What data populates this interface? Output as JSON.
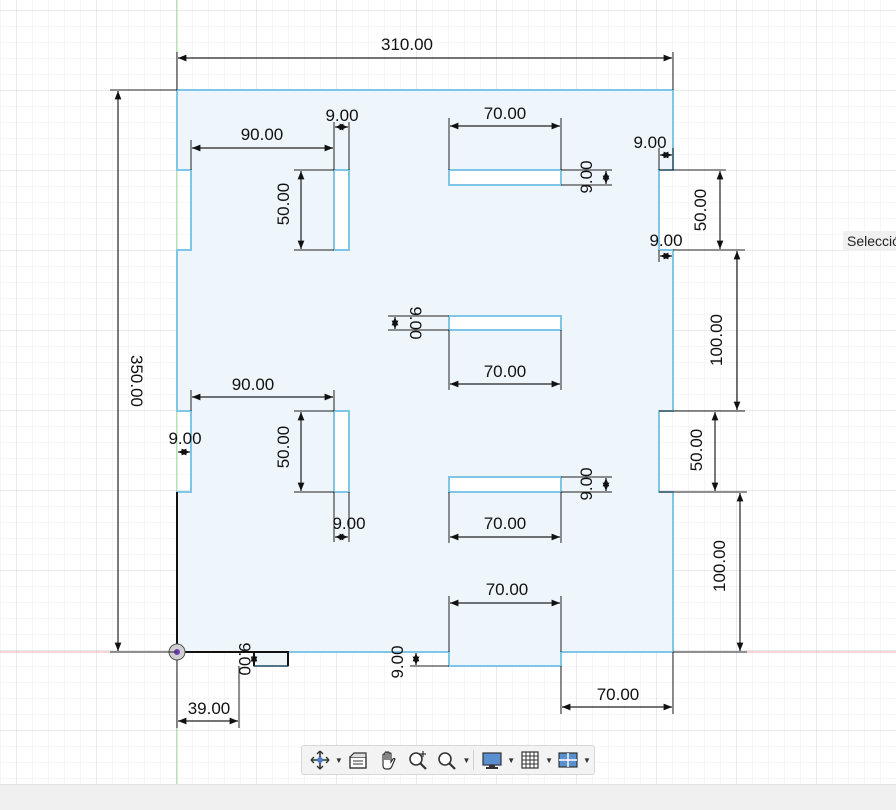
{
  "sketch": {
    "dimensions": {
      "overall_width": "310.00",
      "overall_height": "350.00",
      "left_slot_offset_top": "90.00",
      "left_slot_offset_bottom": "90.00",
      "slot_width_top": "9.00",
      "slot_width_bottom": "9.00",
      "slot_length_left_top": "50.00",
      "slot_length_left_bottom": "50.00",
      "left_notch_depth": "9.00",
      "top_slot_length": "70.00",
      "top_slot_width": "9.00",
      "mid_slot_width": "9.00",
      "mid_slot_length": "70.00",
      "lower_slot_width": "9.00",
      "lower_slot_length": "70.00",
      "bottom_tab_length": "70.00",
      "right_notch_top_depth": "9.00",
      "right_notch_top_depth_2": "9.00",
      "right_notch_top_length": "50.00",
      "right_span_mid": "100.00",
      "right_notch_bottom_length": "50.00",
      "right_span_bottom": "100.00",
      "bottom_tab_depth": "9.00",
      "bottom_left_offset": "39.00",
      "bottom_left_tab_depth": "9.00",
      "bottom_right_tab_length": "70.00"
    }
  },
  "selection_label": "Selección",
  "toolbar": {
    "items": [
      "orbit-icon",
      "look-at-icon",
      "pan-icon",
      "zoom-icon",
      "fit-icon",
      "display-settings-icon",
      "grid-settings-icon",
      "viewports-icon"
    ]
  }
}
